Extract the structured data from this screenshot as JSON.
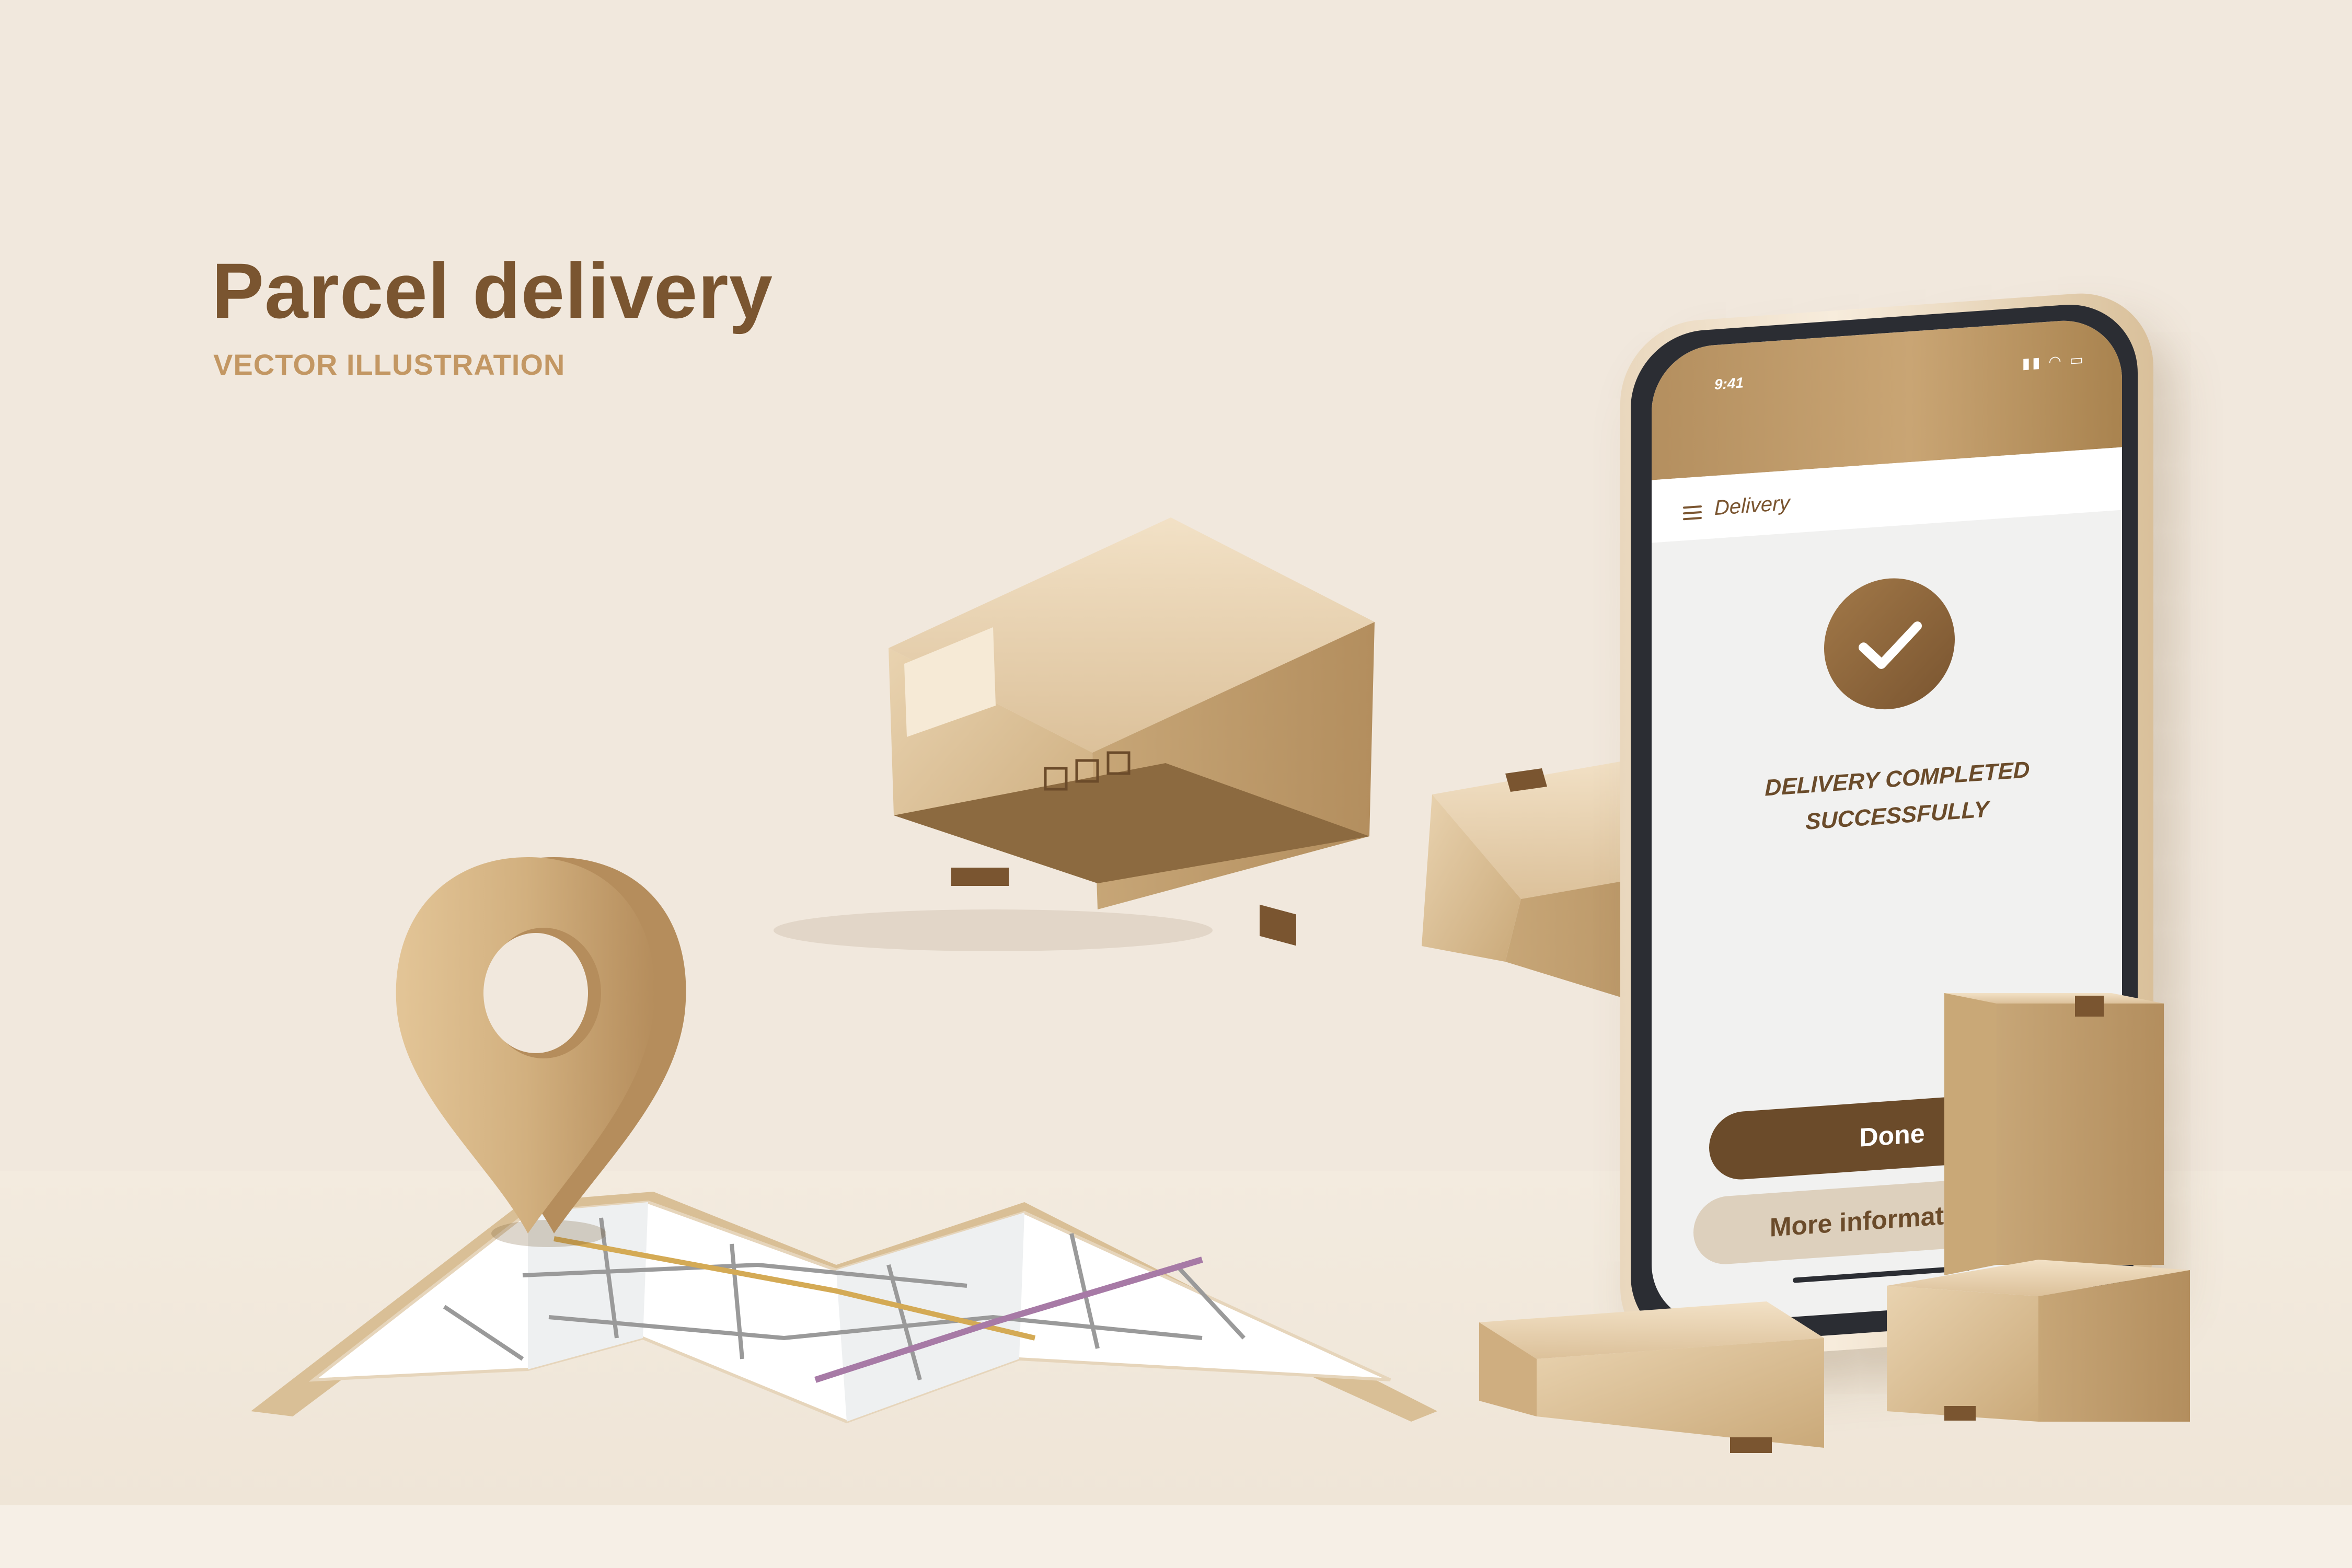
{
  "headline": "Parcel delivery",
  "subheadline": "VECTOR ILLUSTRATION",
  "phone": {
    "status_time": "9:41",
    "status_icons": "▮▮ ◠ ▭",
    "app_title": "Delivery",
    "message": "DELIVERY COMPLETED SUCCESSFULLY",
    "done_label": "Done",
    "more_label": "More information"
  },
  "icons": [
    "menu-icon",
    "checkmark-icon",
    "map-pin-icon",
    "map-icon",
    "parcel-box-icon"
  ],
  "colors": {
    "background": "#f1e8dd",
    "brand_dark": "#6b4b2a",
    "brand_gold": "#c39763",
    "cardboard": "#d7bb91"
  }
}
